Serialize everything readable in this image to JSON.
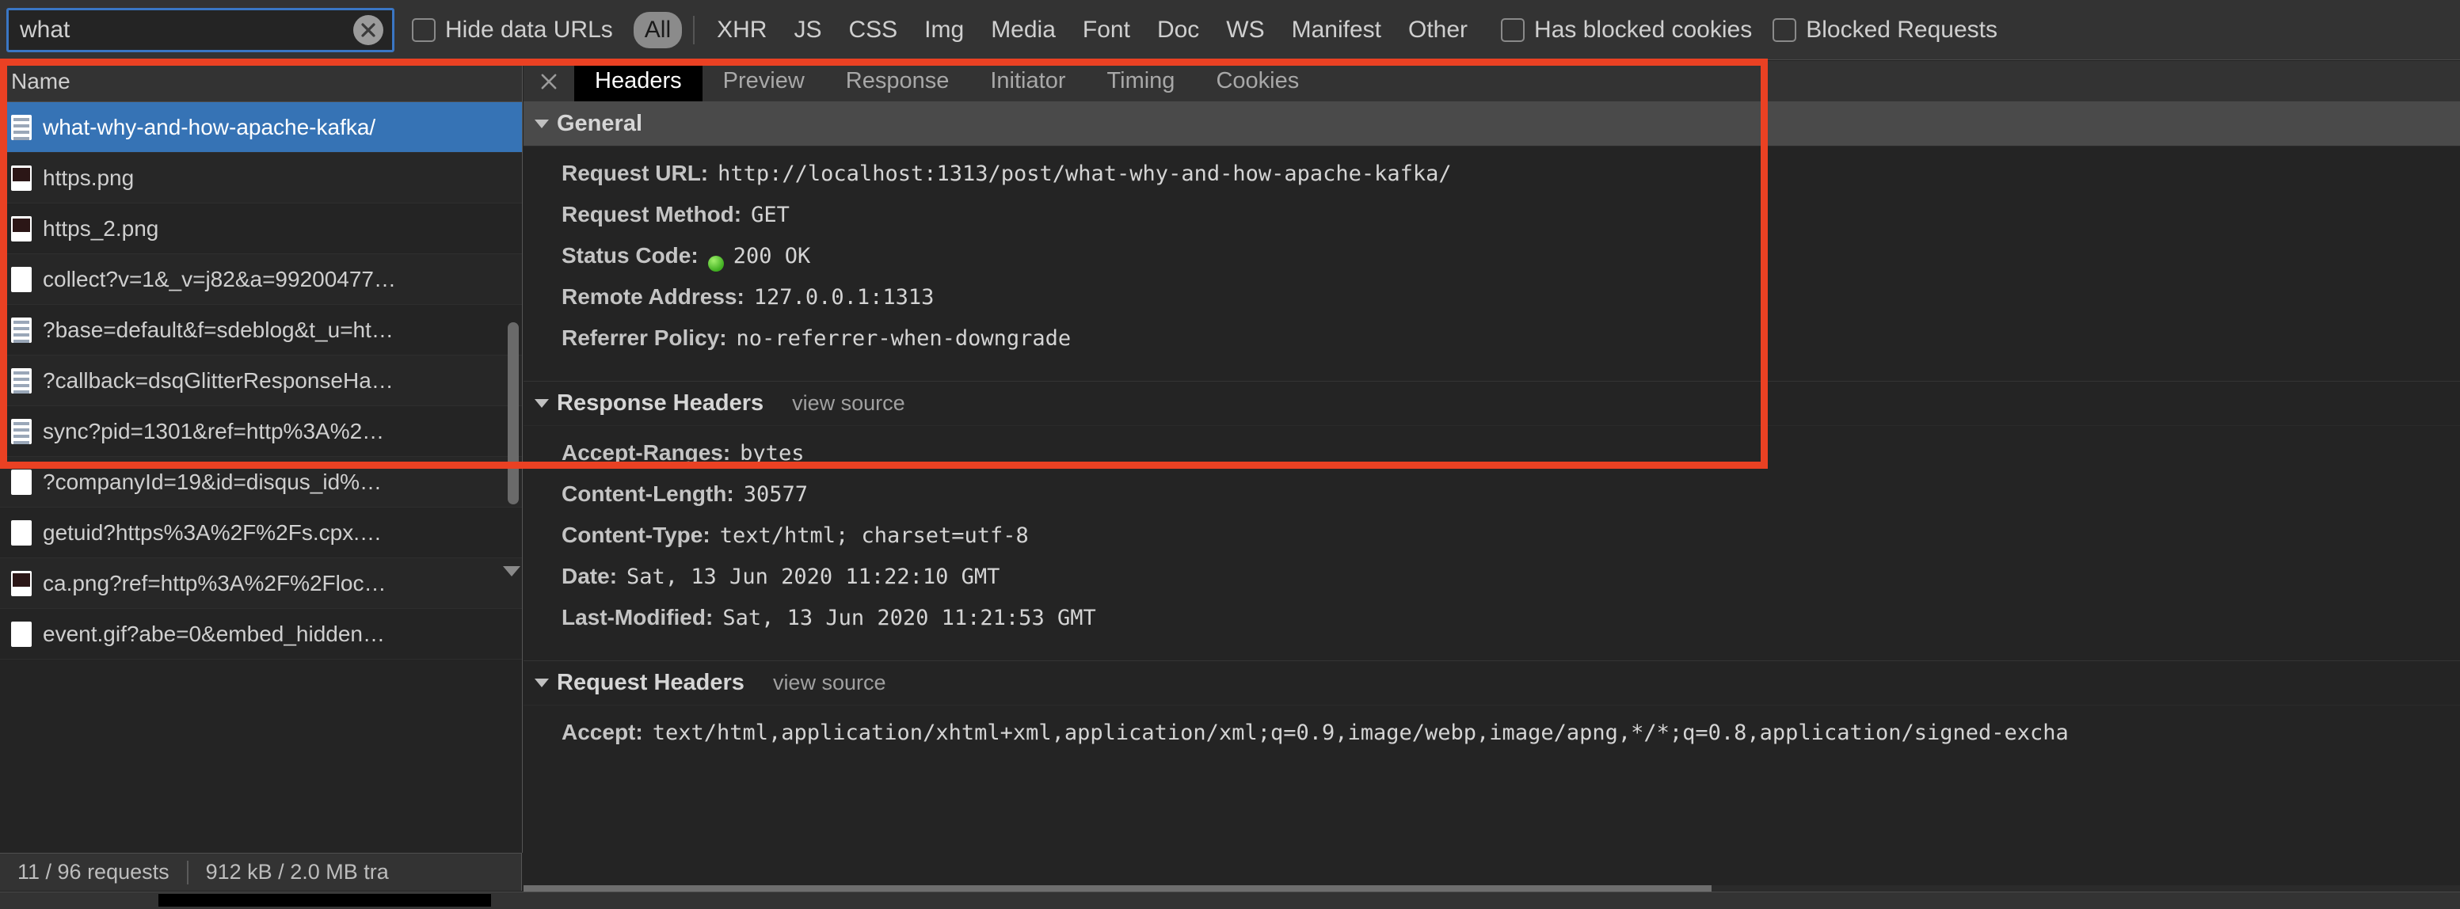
{
  "filter_bar": {
    "search": {
      "value": "what",
      "placeholder": "Filter"
    },
    "clear_icon": "clear-x-icon",
    "hide_data_urls": {
      "label": "Hide data URLs",
      "checked": false
    },
    "types": [
      {
        "label": "All",
        "active": true
      },
      {
        "label": "XHR",
        "active": false
      },
      {
        "label": "JS",
        "active": false
      },
      {
        "label": "CSS",
        "active": false
      },
      {
        "label": "Img",
        "active": false
      },
      {
        "label": "Media",
        "active": false
      },
      {
        "label": "Font",
        "active": false
      },
      {
        "label": "Doc",
        "active": false
      },
      {
        "label": "WS",
        "active": false
      },
      {
        "label": "Manifest",
        "active": false
      },
      {
        "label": "Other",
        "active": false
      }
    ],
    "has_blocked_cookies": {
      "label": "Has blocked cookies",
      "checked": false
    },
    "blocked_requests": {
      "label": "Blocked Requests",
      "checked": false
    }
  },
  "request_list": {
    "column_header": "Name",
    "rows": [
      {
        "name": "what-why-and-how-apache-kafka/",
        "icon": "document-icon",
        "selected": true
      },
      {
        "name": "https.png",
        "icon": "image-icon",
        "selected": false
      },
      {
        "name": "https_2.png",
        "icon": "image-icon",
        "selected": false
      },
      {
        "name": "collect?v=1&_v=j82&a=99200477…",
        "icon": "plain-file-icon",
        "selected": false
      },
      {
        "name": "?base=default&f=sdeblog&t_u=ht…",
        "icon": "document-icon",
        "selected": false
      },
      {
        "name": "?callback=dsqGlitterResponseHa…",
        "icon": "document-icon",
        "selected": false
      },
      {
        "name": "sync?pid=1301&ref=http%3A%2…",
        "icon": "document-icon",
        "selected": false
      },
      {
        "name": "?companyId=19&id=disqus_id%…",
        "icon": "plain-file-icon",
        "selected": false
      },
      {
        "name": "getuid?https%3A%2F%2Fs.cpx.…",
        "icon": "plain-file-icon",
        "selected": false
      },
      {
        "name": "ca.png?ref=http%3A%2F%2Floc…",
        "icon": "image-icon",
        "selected": false
      },
      {
        "name": "event.gif?abe=0&embed_hidden…",
        "icon": "plain-file-icon",
        "selected": false
      }
    ]
  },
  "status_bar": {
    "requests": "11 / 96 requests",
    "transferred": "912 kB / 2.0 MB tra"
  },
  "detail_panel": {
    "close_icon": "close-x-icon",
    "tabs": [
      {
        "label": "Headers",
        "active": true
      },
      {
        "label": "Preview",
        "active": false
      },
      {
        "label": "Response",
        "active": false
      },
      {
        "label": "Initiator",
        "active": false
      },
      {
        "label": "Timing",
        "active": false
      },
      {
        "label": "Cookies",
        "active": false
      }
    ],
    "general": {
      "title": "General",
      "rows": [
        {
          "key": "Request URL:",
          "value": "http://localhost:1313/post/what-why-and-how-apache-kafka/"
        },
        {
          "key": "Request Method:",
          "value": "GET"
        },
        {
          "key": "Status Code:",
          "value": "200 OK",
          "status_dot": "#3fae20"
        },
        {
          "key": "Remote Address:",
          "value": "127.0.0.1:1313"
        },
        {
          "key": "Referrer Policy:",
          "value": "no-referrer-when-downgrade"
        }
      ]
    },
    "response_headers": {
      "title": "Response Headers",
      "view_source": "view source",
      "rows": [
        {
          "key": "Accept-Ranges:",
          "value": "bytes"
        },
        {
          "key": "Content-Length:",
          "value": "30577"
        },
        {
          "key": "Content-Type:",
          "value": "text/html; charset=utf-8"
        },
        {
          "key": "Date:",
          "value": "Sat, 13 Jun 2020 11:22:10 GMT"
        },
        {
          "key": "Last-Modified:",
          "value": "Sat, 13 Jun 2020 11:21:53 GMT"
        }
      ]
    },
    "request_headers": {
      "title": "Request Headers",
      "view_source": "view source",
      "rows": [
        {
          "key": "Accept:",
          "value": "text/html,application/xhtml+xml,application/xml;q=0.9,image/webp,image/apng,*/*;q=0.8,application/signed-excha"
        }
      ]
    }
  },
  "annotation": {
    "color": "#ea4123"
  }
}
